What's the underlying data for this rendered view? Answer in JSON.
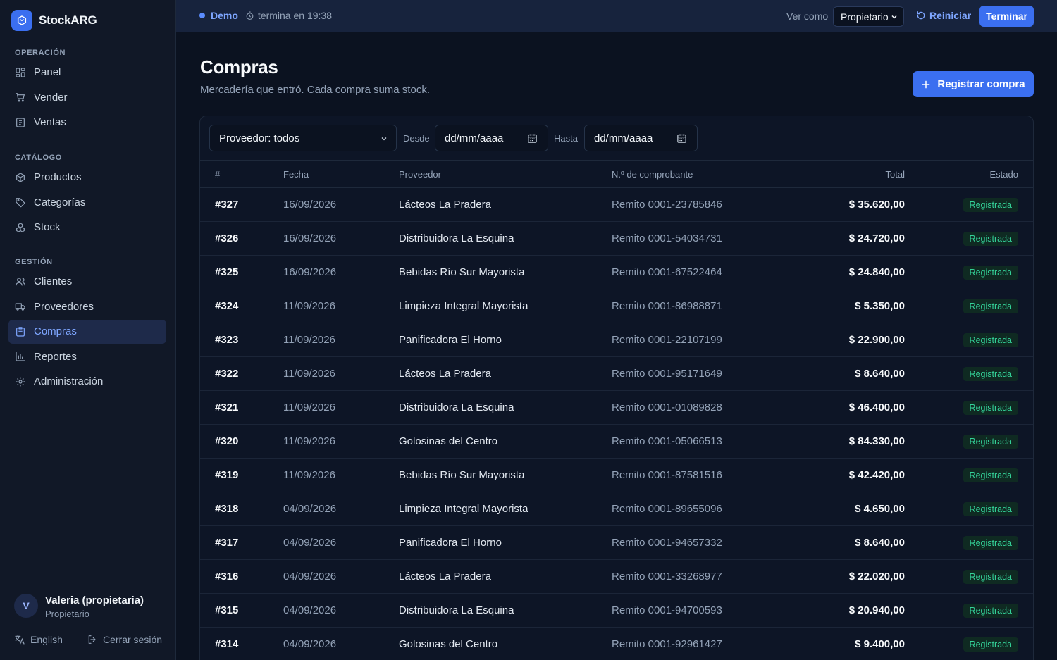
{
  "app": {
    "name": "StockARG"
  },
  "sidebar": {
    "sections": [
      {
        "heading": "OPERACIÓN",
        "items": [
          {
            "label": "Panel",
            "icon": "dashboard-icon"
          },
          {
            "label": "Vender",
            "icon": "cart-icon"
          },
          {
            "label": "Ventas",
            "icon": "receipt-icon"
          }
        ]
      },
      {
        "heading": "CATÁLOGO",
        "items": [
          {
            "label": "Productos",
            "icon": "box-icon"
          },
          {
            "label": "Categorías",
            "icon": "tag-icon"
          },
          {
            "label": "Stock",
            "icon": "boxes-icon"
          }
        ]
      },
      {
        "heading": "GESTIÓN",
        "items": [
          {
            "label": "Clientes",
            "icon": "users-icon"
          },
          {
            "label": "Proveedores",
            "icon": "truck-icon"
          },
          {
            "label": "Compras",
            "icon": "clipboard-icon",
            "active": true
          },
          {
            "label": "Reportes",
            "icon": "bar-chart-icon"
          },
          {
            "label": "Administración",
            "icon": "gear-icon"
          }
        ]
      }
    ],
    "user": {
      "initial": "V",
      "name": "Valeria (propietaria)",
      "role": "Propietario"
    },
    "language_label": "English",
    "logout_label": "Cerrar sesión"
  },
  "topbar": {
    "demo_label": "Demo",
    "timer_text": "termina en 19:38",
    "view_as_label": "Ver como",
    "role_selected": "Propietario",
    "restart_label": "Reiniciar",
    "finish_label": "Terminar"
  },
  "page": {
    "title": "Compras",
    "subtitle": "Mercadería que entró. Cada compra suma stock.",
    "primary_action": "Registrar compra"
  },
  "filters": {
    "supplier_selected": "Proveedor: todos",
    "from_label": "Desde",
    "from_placeholder": "dd/mm/aaaa",
    "to_label": "Hasta",
    "to_placeholder": "dd/mm/aaaa"
  },
  "table": {
    "columns": [
      "#",
      "Fecha",
      "Proveedor",
      "N.º de comprobante",
      "Total",
      "Estado"
    ],
    "rows": [
      {
        "id": "#327",
        "date": "16/09/2026",
        "supplier": "Lácteos La Pradera",
        "doc": "Remito 0001-23785846",
        "total": "$ 35.620,00",
        "status": "Registrada"
      },
      {
        "id": "#326",
        "date": "16/09/2026",
        "supplier": "Distribuidora La Esquina",
        "doc": "Remito 0001-54034731",
        "total": "$ 24.720,00",
        "status": "Registrada"
      },
      {
        "id": "#325",
        "date": "16/09/2026",
        "supplier": "Bebidas Río Sur Mayorista",
        "doc": "Remito 0001-67522464",
        "total": "$ 24.840,00",
        "status": "Registrada"
      },
      {
        "id": "#324",
        "date": "11/09/2026",
        "supplier": "Limpieza Integral Mayorista",
        "doc": "Remito 0001-86988871",
        "total": "$ 5.350,00",
        "status": "Registrada"
      },
      {
        "id": "#323",
        "date": "11/09/2026",
        "supplier": "Panificadora El Horno",
        "doc": "Remito 0001-22107199",
        "total": "$ 22.900,00",
        "status": "Registrada"
      },
      {
        "id": "#322",
        "date": "11/09/2026",
        "supplier": "Lácteos La Pradera",
        "doc": "Remito 0001-95171649",
        "total": "$ 8.640,00",
        "status": "Registrada"
      },
      {
        "id": "#321",
        "date": "11/09/2026",
        "supplier": "Distribuidora La Esquina",
        "doc": "Remito 0001-01089828",
        "total": "$ 46.400,00",
        "status": "Registrada"
      },
      {
        "id": "#320",
        "date": "11/09/2026",
        "supplier": "Golosinas del Centro",
        "doc": "Remito 0001-05066513",
        "total": "$ 84.330,00",
        "status": "Registrada"
      },
      {
        "id": "#319",
        "date": "11/09/2026",
        "supplier": "Bebidas Río Sur Mayorista",
        "doc": "Remito 0001-87581516",
        "total": "$ 42.420,00",
        "status": "Registrada"
      },
      {
        "id": "#318",
        "date": "04/09/2026",
        "supplier": "Limpieza Integral Mayorista",
        "doc": "Remito 0001-89655096",
        "total": "$ 4.650,00",
        "status": "Registrada"
      },
      {
        "id": "#317",
        "date": "04/09/2026",
        "supplier": "Panificadora El Horno",
        "doc": "Remito 0001-94657332",
        "total": "$ 8.640,00",
        "status": "Registrada"
      },
      {
        "id": "#316",
        "date": "04/09/2026",
        "supplier": "Lácteos La Pradera",
        "doc": "Remito 0001-33268977",
        "total": "$ 22.020,00",
        "status": "Registrada"
      },
      {
        "id": "#315",
        "date": "04/09/2026",
        "supplier": "Distribuidora La Esquina",
        "doc": "Remito 0001-94700593",
        "total": "$ 20.940,00",
        "status": "Registrada"
      },
      {
        "id": "#314",
        "date": "04/09/2026",
        "supplier": "Golosinas del Centro",
        "doc": "Remito 0001-92961427",
        "total": "$ 9.400,00",
        "status": "Registrada"
      }
    ]
  },
  "colors": {
    "accent": "#3b6ff0",
    "status_ok": "#34d399",
    "background": "#0b1220"
  }
}
